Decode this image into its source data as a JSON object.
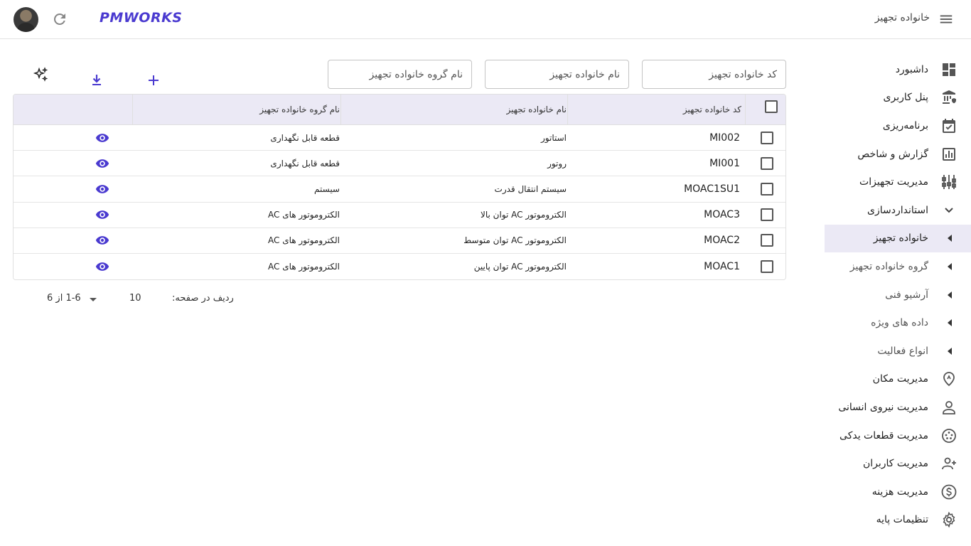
{
  "topbar": {
    "logo": "PMWORKS",
    "title": "خانواده تجهیز"
  },
  "sidebar": {
    "items": [
      {
        "label": "داشبورد"
      },
      {
        "label": "پنل کاربری"
      },
      {
        "label": "برنامه‌ریزی"
      },
      {
        "label": "گزارش و شاخص"
      },
      {
        "label": "مدیریت تجهیزات"
      },
      {
        "label": "استانداردسازی"
      },
      {
        "label": "خانواده تجهیز"
      },
      {
        "label": "گروه خانواده تجهیز"
      },
      {
        "label": "آرشیو فنی"
      },
      {
        "label": "داده های ویژه"
      },
      {
        "label": "انواع فعالیت"
      },
      {
        "label": "مدیریت مکان"
      },
      {
        "label": "مدیریت نیروی انسانی"
      },
      {
        "label": "مدیریت قطعات یدکی"
      },
      {
        "label": "مدیریت کاربران"
      },
      {
        "label": "مدیریت هزینه"
      },
      {
        "label": "تنظیمات پایه"
      }
    ]
  },
  "filters": {
    "code_placeholder": "کد خانواده تجهیز",
    "name_placeholder": "نام خانواده تجهیز",
    "group_placeholder": "نام گروه خانواده تجهیز"
  },
  "table": {
    "headers": {
      "code": "کد خانواده تجهیز",
      "name": "نام خانواده تجهیز",
      "group": "نام گروه خانواده تجهیز"
    },
    "rows": [
      {
        "code": "MI002",
        "name": "استاتور",
        "group": "قطعه قابل نگهداری"
      },
      {
        "code": "MI001",
        "name": "روتور",
        "group": "قطعه قابل نگهداری"
      },
      {
        "code": "MOAC1SU1",
        "name": "سیستم انتقال قدرت",
        "group": "سیستم"
      },
      {
        "code": "MOAC3",
        "name": "الکتروموتور AC توان بالا",
        "group": "الکتروموتور های AC"
      },
      {
        "code": "MOAC2",
        "name": "الکتروموتور AC توان متوسط",
        "group": "الکتروموتور های AC"
      },
      {
        "code": "MOAC1",
        "name": "الکتروموتور AC توان پایین",
        "group": "الکتروموتور های AC"
      }
    ]
  },
  "pagination": {
    "rows_per_page_label": "ردیف در صفحه:",
    "rows_per_page_value": "10",
    "range": "1-6 از 6"
  },
  "colors": {
    "accent": "#4a3ad0",
    "header_bg": "#ebe9f5"
  }
}
